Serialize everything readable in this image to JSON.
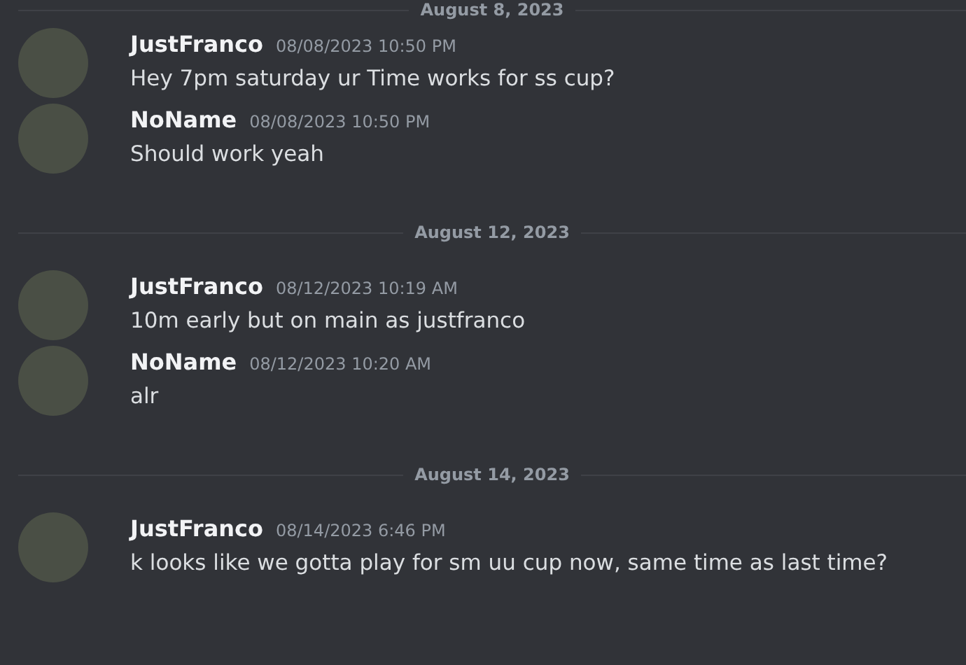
{
  "messages": [
    {
      "kind": "divider",
      "date": "August 8, 2023"
    },
    {
      "kind": "message",
      "author": "JustFranco",
      "timestamp": "08/08/2023 10:50 PM",
      "text": "Hey 7pm saturday ur Time works for ss cup?"
    },
    {
      "kind": "message",
      "author": "NoName",
      "timestamp": "08/08/2023 10:50 PM",
      "text": "Should work yeah"
    },
    {
      "kind": "divider",
      "date": "August 12, 2023"
    },
    {
      "kind": "message",
      "author": "JustFranco",
      "timestamp": "08/12/2023 10:19 AM",
      "text": "10m early but on main as justfranco"
    },
    {
      "kind": "message",
      "author": "NoName",
      "timestamp": "08/12/2023 10:20 AM",
      "text": "alr"
    },
    {
      "kind": "divider",
      "date": "August 14, 2023"
    },
    {
      "kind": "message",
      "author": "JustFranco",
      "timestamp": "08/14/2023 6:46 PM",
      "text": "k looks like we gotta play for sm uu cup now, same time as last time?"
    }
  ]
}
